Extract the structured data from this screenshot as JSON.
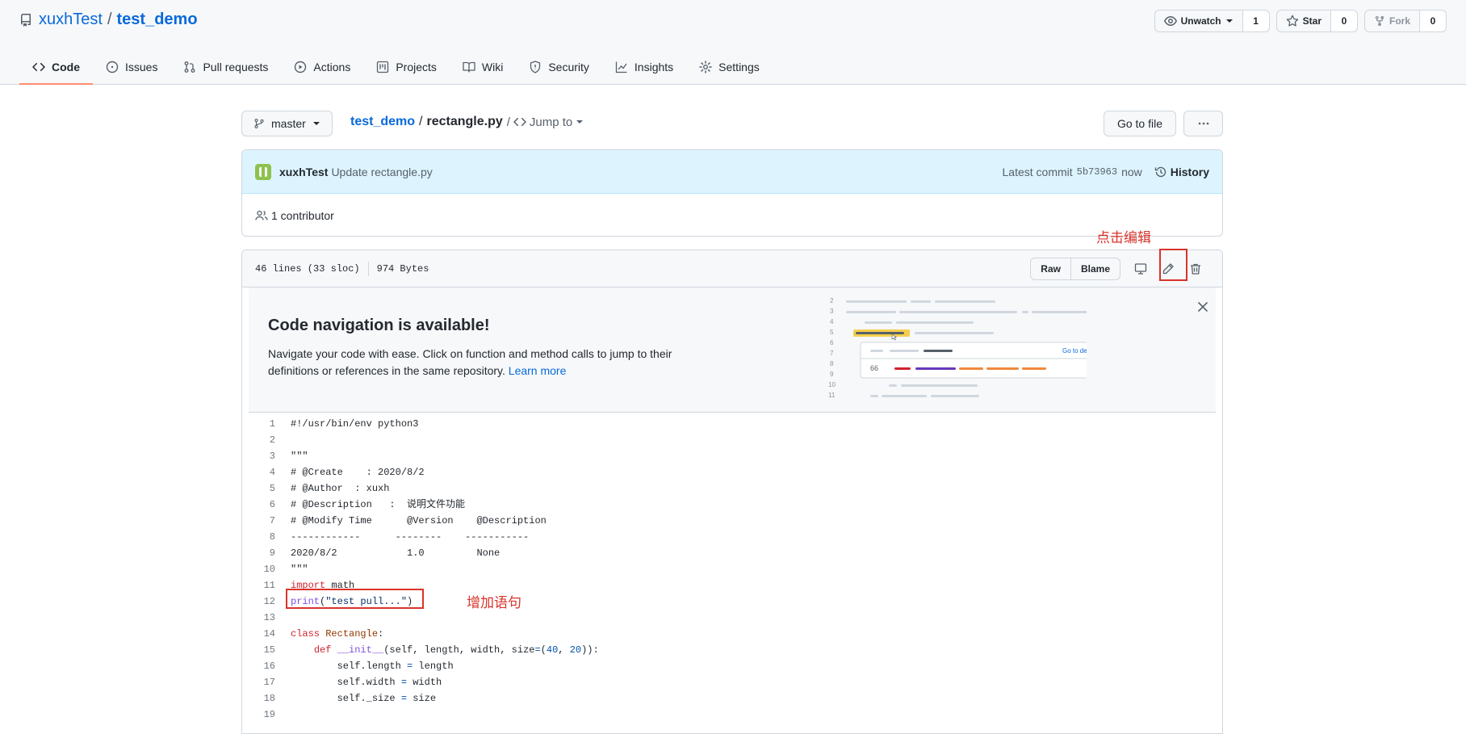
{
  "repo": {
    "owner": "xuxhTest",
    "separator": "/",
    "name": "test_demo"
  },
  "actions": {
    "watch": {
      "label": "Unwatch",
      "count": "1"
    },
    "star": {
      "label": "Star",
      "count": "0"
    },
    "fork": {
      "label": "Fork",
      "count": "0"
    }
  },
  "nav": {
    "tabs": [
      {
        "label": "Code",
        "icon": "code-icon"
      },
      {
        "label": "Issues",
        "icon": "issue-icon"
      },
      {
        "label": "Pull requests",
        "icon": "pull-request-icon"
      },
      {
        "label": "Actions",
        "icon": "play-icon"
      },
      {
        "label": "Projects",
        "icon": "project-icon"
      },
      {
        "label": "Wiki",
        "icon": "book-icon"
      },
      {
        "label": "Security",
        "icon": "shield-icon"
      },
      {
        "label": "Insights",
        "icon": "graph-icon"
      },
      {
        "label": "Settings",
        "icon": "gear-icon"
      }
    ]
  },
  "file_nav": {
    "branch": "master",
    "breadcrumb_repo": "test_demo",
    "breadcrumb_sep": "/",
    "breadcrumb_file": "rectangle.py",
    "jump_sep": "/",
    "jump_label": "Jump to",
    "go_to_file": "Go to file"
  },
  "commit": {
    "author": "xuxhTest",
    "message": "Update rectangle.py",
    "latest_label": "Latest commit",
    "sha": "5b73963",
    "time": "now",
    "history": "History",
    "contributors": "1 contributor"
  },
  "file_header": {
    "lines": "46 lines (33 sloc)",
    "size": "974 Bytes",
    "raw": "Raw",
    "blame": "Blame"
  },
  "code_nav": {
    "title": "Code navigation is available!",
    "description": "Navigate your code with ease. Click on function and method calls to jump to their definitions or references in the same repository.",
    "learn_more": "Learn more",
    "illus_go_to_definition": "Go to definition",
    "illus_ref_line": "66",
    "illus_line_numbers": [
      "2",
      "3",
      "4",
      "5",
      "6",
      "7",
      "8",
      "9",
      "10",
      "11"
    ]
  },
  "annotations": {
    "edit_hint": "点击编辑",
    "add_statement": "增加语句"
  },
  "code_lines": [
    {
      "n": "1",
      "html": "#!/usr/bin/env python3"
    },
    {
      "n": "2",
      "html": ""
    },
    {
      "n": "3",
      "html": "\"\"\""
    },
    {
      "n": "4",
      "html": "# @Create    : 2020/8/2"
    },
    {
      "n": "5",
      "html": "# @Author  : xuxh"
    },
    {
      "n": "6",
      "html": "# @Description   :  说明文件功能"
    },
    {
      "n": "7",
      "html": "# @Modify Time      @Version    @Description"
    },
    {
      "n": "8",
      "html": "------------      --------    -----------"
    },
    {
      "n": "9",
      "html": "2020/8/2            1.0         None"
    },
    {
      "n": "10",
      "html": "\"\"\""
    },
    {
      "n": "11",
      "html": "<span class=\"kw\">import</span> math"
    },
    {
      "n": "12",
      "html": "<span class=\"fn\">print</span>(<span class=\"str\">\"test pull...\"</span>)"
    },
    {
      "n": "13",
      "html": ""
    },
    {
      "n": "14",
      "html": "<span class=\"kw\">class</span> <span class=\"cls\">Rectangle</span>:"
    },
    {
      "n": "15",
      "html": "    <span class=\"kw\">def</span> <span class=\"fn\">__init__</span>(self, length, width, size<span class=\"op\">=</span>(<span class=\"num\">40</span>, <span class=\"num\">20</span>)):"
    },
    {
      "n": "16",
      "html": "        self.length <span class=\"op\">=</span> length"
    },
    {
      "n": "17",
      "html": "        self.width <span class=\"op\">=</span> width"
    },
    {
      "n": "18",
      "html": "        self._size <span class=\"op\">=</span> size"
    },
    {
      "n": "19",
      "html": ""
    }
  ]
}
